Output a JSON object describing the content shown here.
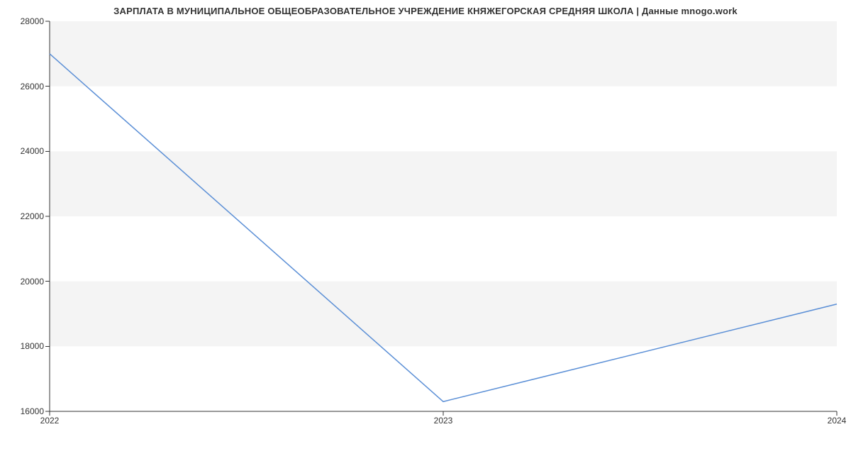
{
  "chart_data": {
    "type": "line",
    "title": "ЗАРПЛАТА В МУНИЦИПАЛЬНОЕ ОБЩЕОБРАЗОВАТЕЛЬНОЕ УЧРЕЖДЕНИЕ КНЯЖЕГОРСКАЯ СРЕДНЯЯ ШКОЛА | Данные mnogo.work",
    "xlabel": "",
    "ylabel": "",
    "x_tick_labels": [
      "2022",
      "2023",
      "2024"
    ],
    "y_tick_labels": [
      "16000",
      "18000",
      "20000",
      "22000",
      "24000",
      "26000",
      "28000"
    ],
    "x": [
      2022,
      2023,
      2024
    ],
    "values": [
      27000,
      16300,
      19300
    ],
    "xlim": [
      2022,
      2024
    ],
    "ylim": [
      16000,
      28000
    ],
    "line_color": "#5b8fd6"
  }
}
